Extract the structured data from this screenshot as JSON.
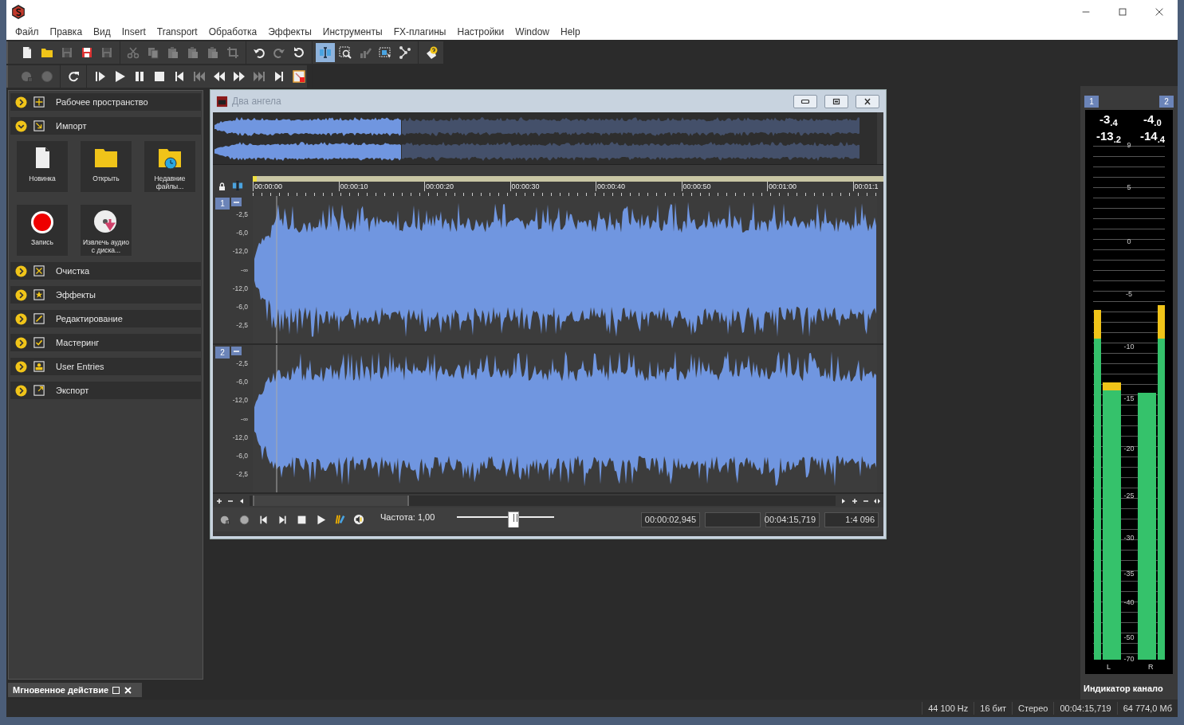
{
  "window": {
    "title": "Два ангела"
  },
  "menu": [
    "Файл",
    "Правка",
    "Вид",
    "Insert",
    "Transport",
    "Обработка",
    "Эффекты",
    "Инструменты",
    "FX-плагины",
    "Настройки",
    "Window",
    "Help"
  ],
  "toolbar_rows": [
    [
      [
        {
          "kind": "new",
          "disabled": false,
          "active": false
        },
        {
          "kind": "open",
          "disabled": false,
          "active": false
        },
        {
          "kind": "save",
          "disabled": true,
          "active": false
        },
        {
          "kind": "save_as",
          "disabled": false,
          "active": false
        },
        {
          "kind": "save",
          "disabled": true,
          "active": false
        }
      ],
      [
        {
          "kind": "cut",
          "disabled": true,
          "active": false
        },
        {
          "kind": "copy",
          "disabled": true,
          "active": false
        },
        {
          "kind": "paste",
          "disabled": true,
          "active": false
        },
        {
          "kind": "paste",
          "disabled": true,
          "active": false
        },
        {
          "kind": "paste",
          "disabled": true,
          "active": false
        },
        {
          "kind": "crop",
          "disabled": true,
          "active": false
        }
      ],
      [
        {
          "kind": "undo",
          "disabled": false,
          "active": false
        },
        {
          "kind": "redo",
          "disabled": true,
          "active": false
        },
        {
          "kind": "revert",
          "disabled": false,
          "active": false
        }
      ],
      [
        {
          "kind": "select",
          "disabled": false,
          "active": true
        },
        {
          "kind": "zoom",
          "disabled": false,
          "active": false
        },
        {
          "kind": "pencil",
          "disabled": true,
          "active": false
        },
        {
          "kind": "region",
          "disabled": false,
          "active": false
        },
        {
          "kind": "nodes",
          "disabled": false,
          "active": false
        }
      ],
      [
        {
          "kind": "help",
          "disabled": false,
          "active": false
        }
      ]
    ],
    [
      [
        {
          "kind": "record_pause",
          "disabled": true,
          "active": false
        },
        {
          "kind": "record",
          "disabled": true,
          "active": false
        }
      ],
      [
        {
          "kind": "loop",
          "disabled": false,
          "active": false
        }
      ],
      [
        {
          "kind": "play_from",
          "disabled": false,
          "active": false
        },
        {
          "kind": "play",
          "disabled": false,
          "active": false
        },
        {
          "kind": "pause",
          "disabled": false,
          "active": false
        },
        {
          "kind": "stop",
          "disabled": false,
          "active": false
        },
        {
          "kind": "go_start",
          "disabled": false,
          "active": false
        },
        {
          "kind": "prev",
          "disabled": true,
          "active": false
        },
        {
          "kind": "rewind",
          "disabled": false,
          "active": false
        },
        {
          "kind": "forward",
          "disabled": false,
          "active": false
        },
        {
          "kind": "next",
          "disabled": true,
          "active": false
        },
        {
          "kind": "go_end",
          "disabled": false,
          "active": false
        },
        {
          "kind": "export",
          "disabled": false,
          "active": false
        }
      ]
    ]
  ],
  "panel": {
    "sections": [
      {
        "label": "Рабочее пространство",
        "kind": "workspace",
        "expanded": false
      },
      {
        "label": "Импорт",
        "kind": "import",
        "expanded": true,
        "tiles": [
          {
            "label": "Новинка",
            "kind": "new"
          },
          {
            "label": "Открыть",
            "kind": "open"
          },
          {
            "label": "Недавние файлы...",
            "kind": "recent"
          },
          {
            "label": "Запись",
            "kind": "record"
          },
          {
            "label": "Извлечь аудио с диска...",
            "kind": "disc"
          }
        ]
      },
      {
        "label": "Очистка",
        "kind": "cleanup",
        "expanded": false
      },
      {
        "label": "Эффекты",
        "kind": "effects",
        "expanded": false
      },
      {
        "label": "Редактирование",
        "kind": "edit",
        "expanded": false
      },
      {
        "label": "Мастеринг",
        "kind": "mastering",
        "expanded": false
      },
      {
        "label": "User Entries",
        "kind": "user",
        "expanded": false
      },
      {
        "label": "Экспорт",
        "kind": "export",
        "expanded": false
      }
    ],
    "footer_tab": "Мгновенное действие"
  },
  "document": {
    "ruler": [
      "00:00:00",
      "00:00:10",
      "00:00:20",
      "00:00:30",
      "00:00:40",
      "00:00:50",
      "00:01:00",
      "00:01:1"
    ],
    "channels": [
      {
        "number": "1",
        "scale": [
          "-2,5",
          "-6,0",
          "-12,0",
          "-∞",
          "-12,0",
          "-6,0",
          "-2,5"
        ]
      },
      {
        "number": "2",
        "scale": [
          "-2,5",
          "-6,0",
          "-12,0",
          "-∞",
          "-12,0",
          "-6,0",
          "-2,5"
        ]
      }
    ],
    "rate_label": "Частота: 1,00",
    "rate_slider": {
      "level": 0.58
    },
    "time_fields": [
      "00:00:02,945",
      "00:04:15,719",
      "1:4 096"
    ]
  },
  "meters": {
    "channels": [
      {
        "number": "1",
        "peak": "-3$_{.4}$",
        "rms": "-13$_{.2}$",
        "label": "L",
        "peak_meter": {
          "level": 0.68
        },
        "rms_meter": {
          "level": 0.54
        }
      },
      {
        "number": "2",
        "peak": "-4$_{.0}$",
        "rms": "-14$_{.4}$",
        "label": "R",
        "peak_meter": {
          "level": 0.69
        },
        "rms_meter": {
          "level": 0.52
        }
      }
    ],
    "scale": [
      "9",
      "5",
      "0",
      "-5",
      "-10",
      "-15",
      "-20",
      "-25",
      "-30",
      "-35",
      "-40",
      "-50",
      "-70"
    ],
    "caption": "Индикатор канало"
  },
  "status_bar": [
    "44 100 Hz",
    "16 бит",
    "Стерео",
    "00:04:15,719",
    "64 774,0 Мб"
  ]
}
